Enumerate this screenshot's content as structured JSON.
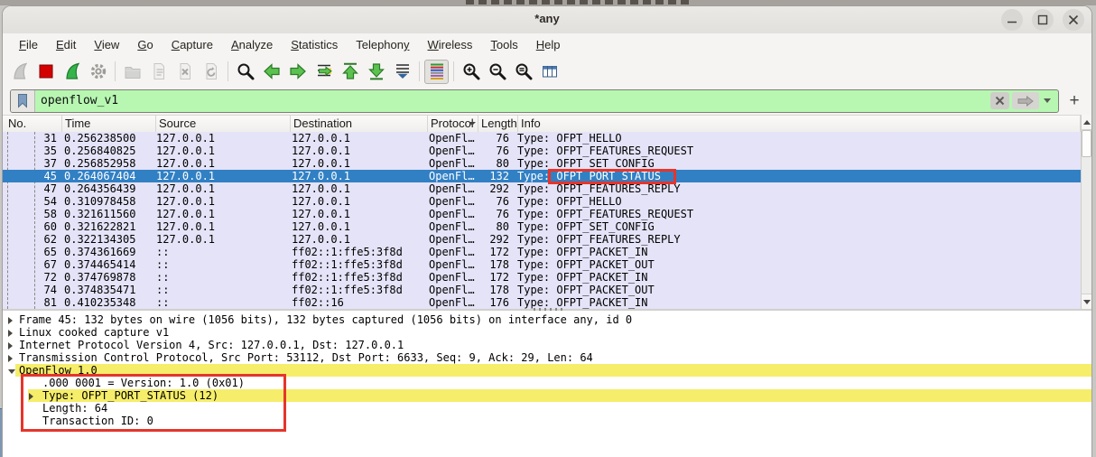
{
  "window": {
    "title": "*any",
    "controls": [
      "minimize",
      "maximize",
      "close"
    ]
  },
  "menu": {
    "items": [
      {
        "label": "File",
        "u": 0
      },
      {
        "label": "Edit",
        "u": 0
      },
      {
        "label": "View",
        "u": 0
      },
      {
        "label": "Go",
        "u": 0
      },
      {
        "label": "Capture",
        "u": 0
      },
      {
        "label": "Analyze",
        "u": 0
      },
      {
        "label": "Statistics",
        "u": 0
      },
      {
        "label": "Telephony",
        "u": 8
      },
      {
        "label": "Wireless",
        "u": 0
      },
      {
        "label": "Tools",
        "u": 0
      },
      {
        "label": "Help",
        "u": 0
      }
    ]
  },
  "toolbar": {
    "buttons": [
      {
        "name": "start-capture",
        "icon": "fin-gray",
        "disabled": true
      },
      {
        "name": "stop-capture",
        "icon": "stop"
      },
      {
        "name": "restart-capture",
        "icon": "fin-green"
      },
      {
        "name": "capture-options",
        "icon": "gear"
      },
      {
        "sep": true
      },
      {
        "name": "open-file",
        "icon": "folder",
        "disabled": true
      },
      {
        "name": "save-file",
        "icon": "doc-save",
        "disabled": true
      },
      {
        "name": "close-file",
        "icon": "doc-close",
        "disabled": true
      },
      {
        "name": "reload-file",
        "icon": "doc-reload",
        "disabled": true
      },
      {
        "sep": true
      },
      {
        "name": "find-packet",
        "icon": "magnifier"
      },
      {
        "name": "go-back",
        "icon": "arrow-left"
      },
      {
        "name": "go-forward",
        "icon": "arrow-right"
      },
      {
        "name": "go-to-packet",
        "icon": "goto"
      },
      {
        "name": "go-first",
        "icon": "arrow-up-bar"
      },
      {
        "name": "go-last",
        "icon": "arrow-down-bar"
      },
      {
        "name": "auto-scroll",
        "icon": "autoscroll"
      },
      {
        "sep": true
      },
      {
        "name": "colorize",
        "icon": "colorize",
        "pressed": true
      },
      {
        "sep": true
      },
      {
        "name": "zoom-in",
        "icon": "mag-plus"
      },
      {
        "name": "zoom-out",
        "icon": "mag-minus"
      },
      {
        "name": "zoom-reset",
        "icon": "mag-equal"
      },
      {
        "name": "resize-columns",
        "icon": "table"
      }
    ]
  },
  "filter": {
    "value": "openflow_v1",
    "valid_color": "#b7f7b2",
    "add_button_label": "+"
  },
  "packet_list": {
    "columns": [
      "No.",
      "Time",
      "Source",
      "Destination",
      "Protocol",
      "Length",
      "Info"
    ],
    "selected_no": "45",
    "rows": [
      {
        "no": "31",
        "time": "0.256238500",
        "src": "127.0.0.1",
        "dst": "127.0.0.1",
        "proto": "OpenFl…",
        "len": "76",
        "info": "Type: OFPT_HELLO"
      },
      {
        "no": "35",
        "time": "0.256840825",
        "src": "127.0.0.1",
        "dst": "127.0.0.1",
        "proto": "OpenFl…",
        "len": "76",
        "info": "Type: OFPT_FEATURES_REQUEST"
      },
      {
        "no": "37",
        "time": "0.256852958",
        "src": "127.0.0.1",
        "dst": "127.0.0.1",
        "proto": "OpenFl…",
        "len": "80",
        "info": "Type: OFPT_SET_CONFIG"
      },
      {
        "no": "45",
        "time": "0.264067404",
        "src": "127.0.0.1",
        "dst": "127.0.0.1",
        "proto": "OpenFl…",
        "len": "132",
        "info": "Type: OFPT_PORT_STATUS",
        "selected": true,
        "annotated": true
      },
      {
        "no": "47",
        "time": "0.264356439",
        "src": "127.0.0.1",
        "dst": "127.0.0.1",
        "proto": "OpenFl…",
        "len": "292",
        "info": "Type: OFPT_FEATURES_REPLY"
      },
      {
        "no": "54",
        "time": "0.310978458",
        "src": "127.0.0.1",
        "dst": "127.0.0.1",
        "proto": "OpenFl…",
        "len": "76",
        "info": "Type: OFPT_HELLO"
      },
      {
        "no": "58",
        "time": "0.321611560",
        "src": "127.0.0.1",
        "dst": "127.0.0.1",
        "proto": "OpenFl…",
        "len": "76",
        "info": "Type: OFPT_FEATURES_REQUEST"
      },
      {
        "no": "60",
        "time": "0.321622821",
        "src": "127.0.0.1",
        "dst": "127.0.0.1",
        "proto": "OpenFl…",
        "len": "80",
        "info": "Type: OFPT_SET_CONFIG"
      },
      {
        "no": "62",
        "time": "0.322134305",
        "src": "127.0.0.1",
        "dst": "127.0.0.1",
        "proto": "OpenFl…",
        "len": "292",
        "info": "Type: OFPT_FEATURES_REPLY"
      },
      {
        "no": "65",
        "time": "0.374361669",
        "src": "::",
        "dst": "ff02::1:ffe5:3f8d",
        "proto": "OpenFl…",
        "len": "172",
        "info": "Type: OFPT_PACKET_IN"
      },
      {
        "no": "67",
        "time": "0.374465414",
        "src": "::",
        "dst": "ff02::1:ffe5:3f8d",
        "proto": "OpenFl…",
        "len": "178",
        "info": "Type: OFPT_PACKET_OUT"
      },
      {
        "no": "72",
        "time": "0.374769878",
        "src": "::",
        "dst": "ff02::1:ffe5:3f8d",
        "proto": "OpenFl…",
        "len": "172",
        "info": "Type: OFPT_PACKET_IN"
      },
      {
        "no": "74",
        "time": "0.374835471",
        "src": "::",
        "dst": "ff02::1:ffe5:3f8d",
        "proto": "OpenFl…",
        "len": "178",
        "info": "Type: OFPT_PACKET_OUT"
      },
      {
        "no": "81",
        "time": "0.410235348",
        "src": "::",
        "dst": "ff02::16",
        "proto": "OpenFl…",
        "len": "176",
        "info": "Type: OFPT_PACKET_IN"
      }
    ]
  },
  "packet_details": {
    "rows": [
      {
        "text": "Frame 45: 132 bytes on wire (1056 bits), 132 bytes captured (1056 bits) on interface any, id 0",
        "arrow": "collapsed",
        "indent": 0
      },
      {
        "text": "Linux cooked capture v1",
        "arrow": "collapsed",
        "indent": 0
      },
      {
        "text": "Internet Protocol Version 4, Src: 127.0.0.1, Dst: 127.0.0.1",
        "arrow": "collapsed",
        "indent": 0
      },
      {
        "text": "Transmission Control Protocol, Src Port: 53112, Dst Port: 6633, Seq: 9, Ack: 29, Len: 64",
        "arrow": "collapsed",
        "indent": 0
      },
      {
        "text": "OpenFlow 1.0",
        "arrow": "expanded",
        "indent": 0,
        "highlight": true
      },
      {
        "text": ".000 0001 = Version: 1.0 (0x01)",
        "arrow": "none",
        "indent": 1
      },
      {
        "text": "Type: OFPT_PORT_STATUS (12)",
        "arrow": "collapsed",
        "indent": 1,
        "highlight": true
      },
      {
        "text": "Length: 64",
        "arrow": "none",
        "indent": 1
      },
      {
        "text": "Transaction ID: 0",
        "arrow": "none",
        "indent": 1
      }
    ]
  },
  "annotations": {
    "highlight_color": "#f6ee6a",
    "box_color": "#e5352b",
    "boxed_list_text": "OFPT_PORT_STATUS",
    "boxed_detail_fields": [
      ".000 0001 = Version: 1.0 (0x01)",
      "Type: OFPT_PORT_STATUS (12)",
      "Length: 64",
      "Transaction ID: 0"
    ]
  },
  "colors": {
    "selected_row": "#3180c4",
    "row_background": "#e4e3f7",
    "filter_valid": "#b7f7b2"
  }
}
